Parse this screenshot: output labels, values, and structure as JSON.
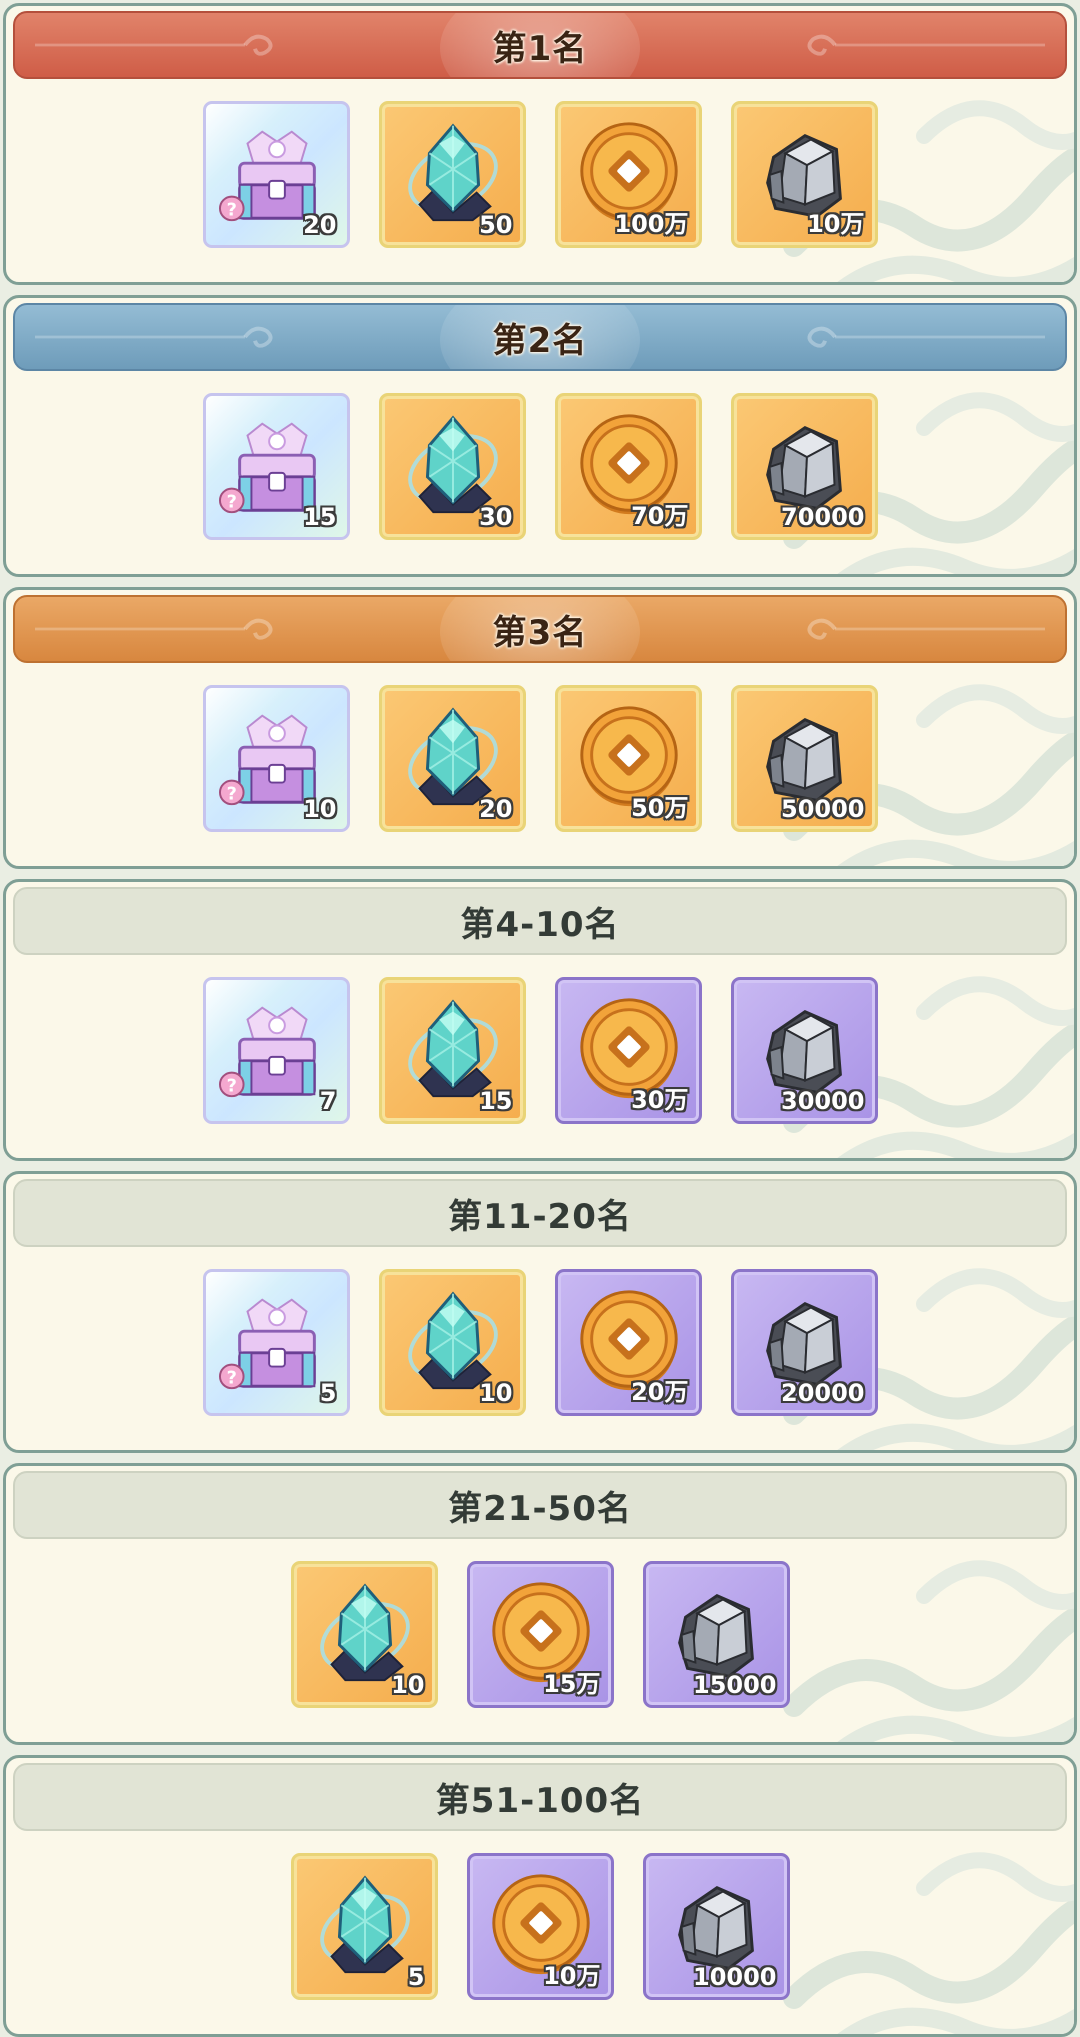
{
  "ranks": [
    {
      "title": "第1名",
      "theme": "red",
      "rewards": [
        {
          "icon": "mystery-chest-icon",
          "qty": "20",
          "frame": "rare"
        },
        {
          "icon": "crystal-ore-icon",
          "qty": "50",
          "frame": "gold"
        },
        {
          "icon": "copper-coin-icon",
          "qty": "100万",
          "frame": "gold"
        },
        {
          "icon": "iron-ore-icon",
          "qty": "10万",
          "frame": "gold"
        }
      ]
    },
    {
      "title": "第2名",
      "theme": "blue",
      "rewards": [
        {
          "icon": "mystery-chest-icon",
          "qty": "15",
          "frame": "rare"
        },
        {
          "icon": "crystal-ore-icon",
          "qty": "30",
          "frame": "gold"
        },
        {
          "icon": "copper-coin-icon",
          "qty": "70万",
          "frame": "gold"
        },
        {
          "icon": "iron-ore-icon",
          "qty": "70000",
          "frame": "gold"
        }
      ]
    },
    {
      "title": "第3名",
      "theme": "orange",
      "rewards": [
        {
          "icon": "mystery-chest-icon",
          "qty": "10",
          "frame": "rare"
        },
        {
          "icon": "crystal-ore-icon",
          "qty": "20",
          "frame": "gold"
        },
        {
          "icon": "copper-coin-icon",
          "qty": "50万",
          "frame": "gold"
        },
        {
          "icon": "iron-ore-icon",
          "qty": "50000",
          "frame": "gold"
        }
      ]
    },
    {
      "title": "第4-10名",
      "theme": "plain",
      "rewards": [
        {
          "icon": "mystery-chest-icon",
          "qty": "7",
          "frame": "rare"
        },
        {
          "icon": "crystal-ore-icon",
          "qty": "15",
          "frame": "gold"
        },
        {
          "icon": "copper-coin-icon",
          "qty": "30万",
          "frame": "purple"
        },
        {
          "icon": "iron-ore-icon",
          "qty": "30000",
          "frame": "purple"
        }
      ]
    },
    {
      "title": "第11-20名",
      "theme": "plain",
      "rewards": [
        {
          "icon": "mystery-chest-icon",
          "qty": "5",
          "frame": "rare"
        },
        {
          "icon": "crystal-ore-icon",
          "qty": "10",
          "frame": "gold"
        },
        {
          "icon": "copper-coin-icon",
          "qty": "20万",
          "frame": "purple"
        },
        {
          "icon": "iron-ore-icon",
          "qty": "20000",
          "frame": "purple"
        }
      ]
    },
    {
      "title": "第21-50名",
      "theme": "plain",
      "rewards": [
        {
          "icon": "crystal-ore-icon",
          "qty": "10",
          "frame": "gold"
        },
        {
          "icon": "copper-coin-icon",
          "qty": "15万",
          "frame": "purple"
        },
        {
          "icon": "iron-ore-icon",
          "qty": "15000",
          "frame": "purple"
        }
      ]
    },
    {
      "title": "第51-100名",
      "theme": "plain",
      "rewards": [
        {
          "icon": "crystal-ore-icon",
          "qty": "5",
          "frame": "gold"
        },
        {
          "icon": "copper-coin-icon",
          "qty": "10万",
          "frame": "purple"
        },
        {
          "icon": "iron-ore-icon",
          "qty": "10000",
          "frame": "purple"
        }
      ]
    }
  ],
  "colors": {
    "background": "#eaeee3",
    "card": "#fbf8e9",
    "card_border": "#7f9f95",
    "banner_red": "#d8684f",
    "banner_blue": "#7faac6",
    "banner_orange": "#e0964f",
    "banner_plain": "#e1e4d5"
  }
}
